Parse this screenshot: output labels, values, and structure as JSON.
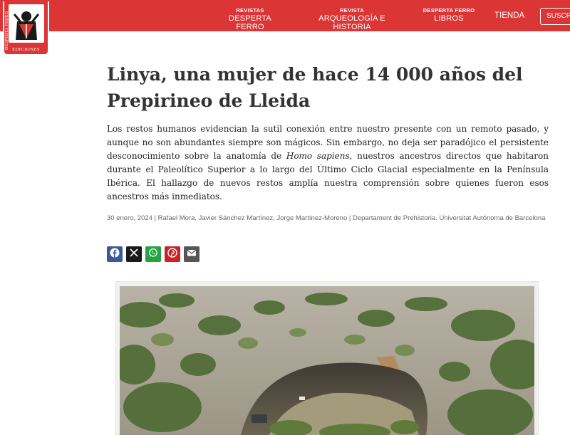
{
  "brand": {
    "logo_vertical_text": "DESPERTA FERRO",
    "logo_bottom_text": "EDICIONES"
  },
  "nav": {
    "items": [
      {
        "small": "REVISTAS",
        "big": "DESPERTA FERRO"
      },
      {
        "small": "REVISTA",
        "big": "ARQUEOLOGÍA E HISTORIA"
      },
      {
        "small": "DESPERTA FERRO",
        "big": "LIBROS"
      }
    ],
    "shop": "TIENDA",
    "subscribe": "SUSCRÍBE"
  },
  "article": {
    "title": "Linya, una mujer de hace 14 000 años del Prepirineo de Lleida",
    "intro_part1": "Los restos humanos evidencian la sutil conexión entre nuestro presente con un remoto pasado, y aunque no son abundantes siempre son mágicos. Sin embargo, no deja ser paradójico el persistente desconocimiento sobre la anatomía de ",
    "intro_italic": "Homo sapiens",
    "intro_part2": ", nuestros ancestros directos que habitaron durante el Paleolítico Superior a lo largo del Último Ciclo Glacial especialmente en la Península Ibérica. El hallazgo de nuevos restos amplía nuestra comprensión sobre quienes fueron esos ancestros más inmediatos.",
    "meta": "30 enero, 2024 | Rafael Mora, Javier Sánchez Martínez, Jorge Martínez-Moreno | Departament de Prehistoria. Universitat Autónoma de Barcelona"
  },
  "share": [
    {
      "icon": "facebook-icon",
      "color": "#3b5998"
    },
    {
      "icon": "x-icon",
      "color": "#1a1a1a"
    },
    {
      "icon": "whatsapp-icon",
      "color": "#25a244"
    },
    {
      "icon": "pinterest-icon",
      "color": "#cb2027"
    },
    {
      "icon": "email-icon",
      "color": "#555555"
    }
  ],
  "colors": {
    "brand_red": "#dc3535"
  }
}
